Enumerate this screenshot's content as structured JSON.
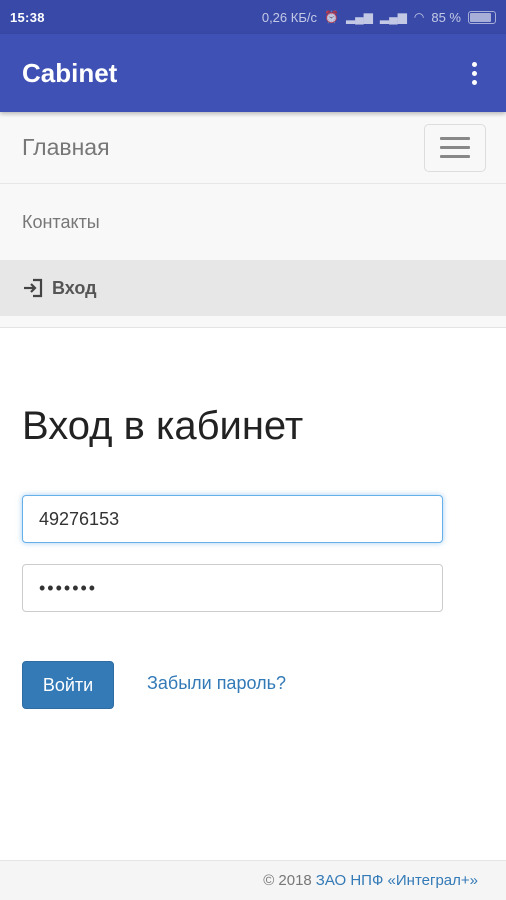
{
  "status_bar": {
    "time": "15:38",
    "net_speed": "0,26 КБ/с",
    "battery": "85 %"
  },
  "appbar": {
    "title": "Cabinet"
  },
  "nav": {
    "brand": "Главная",
    "items": [
      {
        "label": "Контакты"
      },
      {
        "label": "Вход",
        "icon": "login-icon"
      }
    ]
  },
  "main": {
    "title": "Вход в кабинет",
    "login_value": "49276153",
    "password_mask": "•••••••",
    "submit_label": "Войти",
    "forgot_label": "Забыли пароль?"
  },
  "footer": {
    "copyright": "© 2018",
    "company": "ЗАО НПФ «Интеграл+»"
  },
  "colors": {
    "appbar": "#3f51b5",
    "status_bar": "#3849a8",
    "primary_button": "#337ab7",
    "link": "#337ab7"
  }
}
